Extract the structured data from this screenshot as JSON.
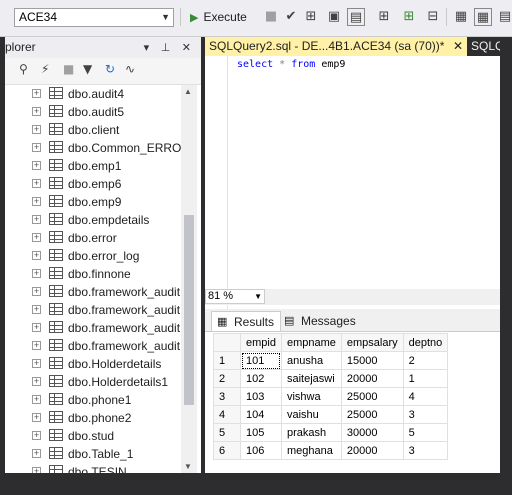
{
  "toolbar": {
    "database": "ACE34",
    "execute_label": "Execute"
  },
  "object_explorer": {
    "title": "plorer",
    "tables": [
      "dbo.audit4",
      "dbo.audit5",
      "dbo.client",
      "dbo.Common_ERROR",
      "dbo.emp1",
      "dbo.emp6",
      "dbo.emp9",
      "dbo.empdetails",
      "dbo.error",
      "dbo.error_log",
      "dbo.finnone",
      "dbo.framework_audit",
      "dbo.framework_audit",
      "dbo.framework_audit",
      "dbo.framework_audit",
      "dbo.Holderdetails",
      "dbo.Holderdetails1",
      "dbo.phone1",
      "dbo.phone2",
      "dbo.stud",
      "dbo.Table_1",
      "dbo.TESIN"
    ]
  },
  "editor": {
    "tab_active": "SQLQuery2.sql - DE...4B1.ACE34 (sa (70))*",
    "tab_close": "✕",
    "tab_next": "SQLQ",
    "query": {
      "kw1": "select",
      "star": "*",
      "kw2": "from",
      "table": "emp9"
    },
    "zoom": "81 %"
  },
  "results": {
    "tab_results": "Results",
    "tab_messages": "Messages",
    "columns": [
      "empid",
      "empname",
      "empsalary",
      "deptno"
    ],
    "rows": [
      [
        "1",
        "101",
        "anusha",
        "15000",
        "2"
      ],
      [
        "2",
        "102",
        "saitejaswi",
        "20000",
        "1"
      ],
      [
        "3",
        "103",
        "vishwa",
        "25000",
        "4"
      ],
      [
        "4",
        "104",
        "vaishu",
        "25000",
        "3"
      ],
      [
        "5",
        "105",
        "prakash",
        "30000",
        "5"
      ],
      [
        "6",
        "106",
        "meghana",
        "20000",
        "3"
      ]
    ]
  }
}
